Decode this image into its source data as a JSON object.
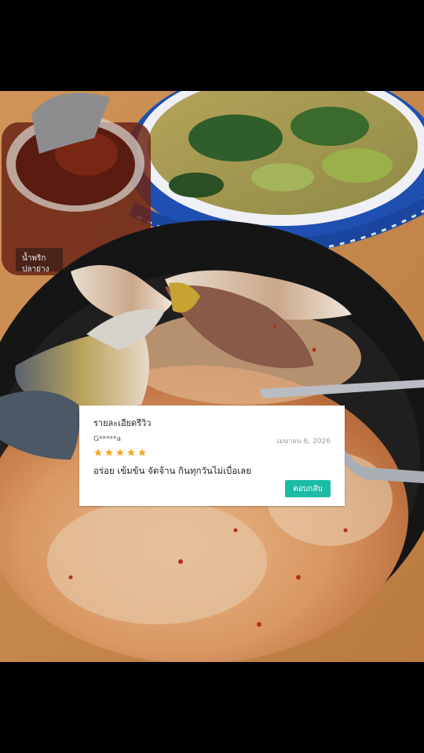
{
  "photo": {
    "subject": "food-photo",
    "jar_label_line1": "น้ำพริก",
    "jar_label_line2": "ปลาย่าง"
  },
  "review_card": {
    "title": "รายละเอียดรีวิว",
    "reviewer": "G*****a",
    "date": "เมษายน 6, 2026",
    "rating": 5,
    "text": "อร่อย เข้มข้น จัดจ้าน กินทุกวันไม่เบื่อเลย",
    "reply_label": "ตอบกลับ",
    "star_color": "#f5a623",
    "button_color": "#1cbba6"
  }
}
